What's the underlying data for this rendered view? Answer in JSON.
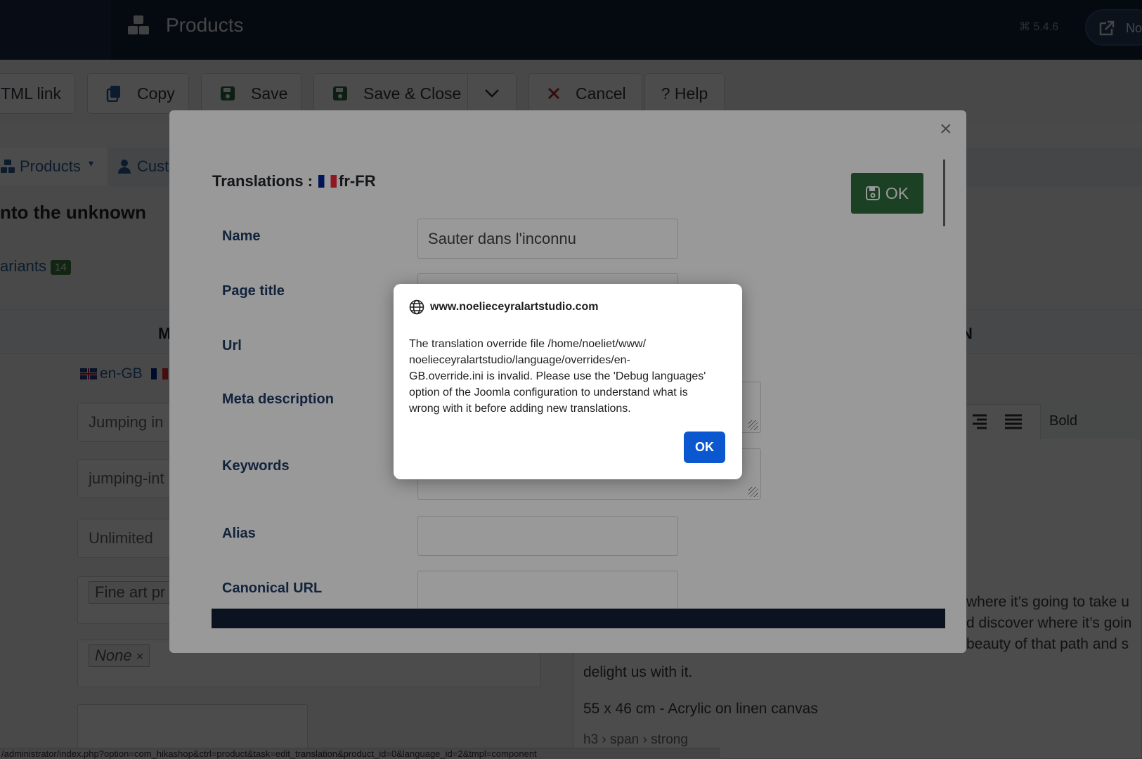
{
  "header": {
    "title": "Products",
    "version": "5.4.6",
    "site_button_label": "Noe"
  },
  "toolbar": {
    "html_link_label": "TML link",
    "copy_label": "Copy",
    "save_label": "Save",
    "save_close_label": "Save & Close",
    "cancel_label": "Cancel",
    "help_label": "? Help"
  },
  "page": {
    "tabs": {
      "products_label": "Products",
      "customers_label": "Cust"
    },
    "heading": "nto the unknown",
    "variants_label": "ariants",
    "variants_count": "14",
    "column_left_letter": "M",
    "column_right_letter": "N",
    "lang_label": "en-GB",
    "fields": {
      "name_value": "Jumping in",
      "alias_value": "jumping-int",
      "quantity_value": "Unlimited",
      "category_value": "Fine art pr",
      "tag_value": "None"
    },
    "editor": {
      "format_label": "Bold",
      "lines": [
        "where it’s going to take u",
        "d discover where it’s goin",
        "beauty of that path and s",
        "delight us with it."
      ],
      "dimensions_line": "55 x 46 cm - Acrylic on linen canvas",
      "path_label": "h3 › span › strong"
    },
    "status_url": "/administrator/index.php?option=com_hikashop&ctrl=product&task=edit_translation&product_id=0&language_id=2&tmpl=component"
  },
  "modal": {
    "close_glyph": "×",
    "heading_prefix": "Translations :",
    "language_code": "fr-FR",
    "ok_label": "OK",
    "fields": {
      "name_label": "Name",
      "name_value": "Sauter dans l'inconnu",
      "page_title_label": "Page title",
      "url_label": "Url",
      "meta_description_label": "Meta description",
      "keywords_label": "Keywords",
      "alias_label": "Alias",
      "canonical_label": "Canonical URL"
    }
  },
  "alert": {
    "host": "www.noelieceyralartstudio.com",
    "message": "The translation override file /home/noeliet/www/\nnoelieceyralartstudio/language/overrides/en-\nGB.override.ini is invalid. Please use the 'Debug languages'\noption of the Joomla configuration to understand what is\nwrong with it before adding new translations.",
    "ok_label": "OK",
    "accent_color": "#0b57d0"
  }
}
